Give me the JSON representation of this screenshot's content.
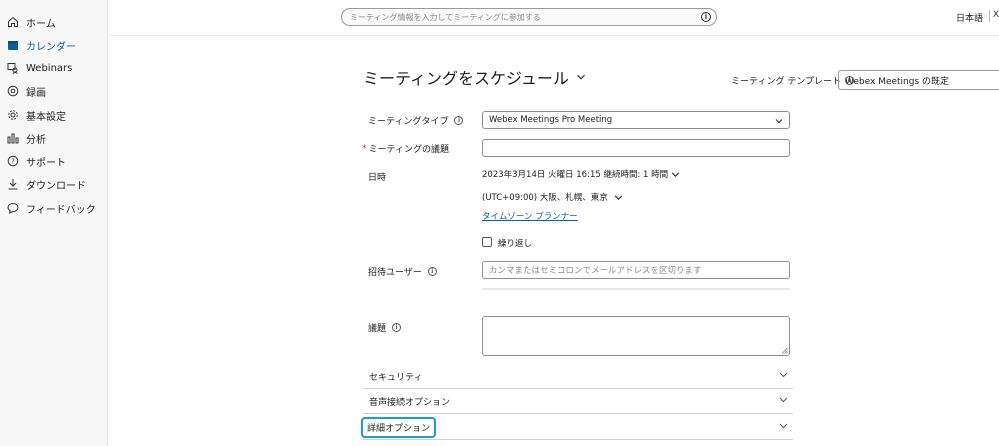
{
  "sidebar": {
    "items": [
      {
        "label": "ホーム",
        "icon": "home-icon"
      },
      {
        "label": "カレンダー",
        "icon": "calendar-icon"
      },
      {
        "label": "Webinars",
        "icon": "webinars-icon"
      },
      {
        "label": "録画",
        "icon": "recording-icon"
      },
      {
        "label": "基本設定",
        "icon": "gear-icon"
      },
      {
        "label": "分析",
        "icon": "analytics-icon"
      },
      {
        "label": "サポート",
        "icon": "help-icon"
      },
      {
        "label": "ダウンロード",
        "icon": "download-icon"
      },
      {
        "label": "フィードバック",
        "icon": "feedback-icon"
      }
    ],
    "active_index": 1
  },
  "topbar": {
    "search_placeholder": "ミーティング情報を入力してミーティングに参加する",
    "info_glyph": "i",
    "language": "日本語",
    "close_glyph": "X"
  },
  "page": {
    "title": "ミーティングをスケジュール",
    "template_label": "ミーティング テンプレート",
    "template_value": "Webex Meetings の既定"
  },
  "form": {
    "meeting_type_label": "ミーティングタイプ",
    "meeting_type_value": "Webex Meetings Pro Meeting",
    "required_mark": "*",
    "topic_label": "ミーティングの議題",
    "topic_value": "",
    "datetime_label": "日時",
    "datetime_value": "2023年3月14日 火曜日 16:15 継続時間: 1 時間",
    "timezone_value": "(UTC+09:00) 大阪、札幌、東京",
    "timezone_planner_link": "タイムゾーン プランナー",
    "recurrence_label": "繰り返し",
    "invitees_label": "招待ユーザー",
    "invitees_placeholder": "カンマまたはセミコロンでメールアドレスを区切ります",
    "agenda_label": "議題",
    "agenda_value": ""
  },
  "sections": [
    {
      "label": "セキュリティ"
    },
    {
      "label": "音声接続オプション"
    },
    {
      "label": "詳細オプション"
    }
  ],
  "colors": {
    "accent": "#0a5fa3",
    "highlight": "#1d9ad6",
    "required": "#d6262b"
  }
}
